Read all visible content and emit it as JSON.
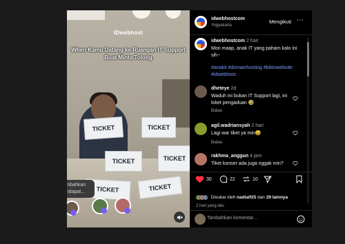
{
  "post": {
    "account": "idwebhostcom",
    "location": "Yogyakarta",
    "follow_label": "Mengikuti",
    "more_label": "⋯",
    "time": "2 hari",
    "text": "Mon maap, anak IT yang paham kalo ini sih~",
    "hashtags": "#anakit #domainhosting #bikinwebsite #idwebhost"
  },
  "video": {
    "logo": "IDwebhost",
    "caption": "When Kamu Datang ke Ruangan IT Support Buat Minta Tolong",
    "card_text": "TICKET",
    "tooltip": "Tambahkan pendapat..."
  },
  "comments": [
    {
      "user": "dheteye",
      "time": "2d",
      "text": "Waduh ini bukan IT Support lagi, ini loket pengaduan 🤣",
      "reply": "Balas"
    },
    {
      "user": "agil.wadriansyah",
      "time": "2 hari",
      "text": "Lagi war tiket ya min😅",
      "reply": "Balas"
    },
    {
      "user": "rakhma_anggun",
      "time": "4 jam",
      "text": "Tiket konser ada juga nggak min?",
      "reply": "Balas"
    }
  ],
  "actions": {
    "likes": "30",
    "comments": "22",
    "reposts": "10"
  },
  "liked_by": {
    "prefix": "Disukai oleh",
    "user": "nadialf25",
    "joiner": "dan",
    "others": "29 lainnya"
  },
  "posted_ago": "2 hari yang lalu",
  "composer": {
    "placeholder": "Tambahkan komentar..."
  },
  "colors": {
    "heart": "#ff3040",
    "hashtag": "#7b9cff",
    "background": "#000000"
  }
}
